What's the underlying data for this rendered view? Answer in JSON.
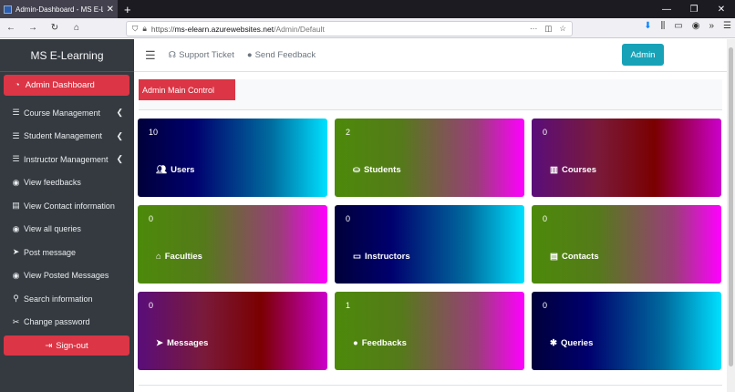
{
  "browser": {
    "tab_title": "Admin-Dashboard - MS E-Lear",
    "url_host": "ms-elearn.azurewebsites.net",
    "url_path": "/Admin/Default",
    "url_scheme": "https://"
  },
  "sidebar": {
    "brand": "MS E-Learning",
    "active_item": "Admin Dashboard",
    "items": [
      {
        "label": "Course Management",
        "icon": "list-icon",
        "has_chevron": true
      },
      {
        "label": "Student Management",
        "icon": "list-icon",
        "has_chevron": true
      },
      {
        "label": "Instructor Management",
        "icon": "list-icon",
        "has_chevron": true
      },
      {
        "label": "View feedbacks",
        "icon": "eye-icon"
      },
      {
        "label": "View Contact information",
        "icon": "id-card-icon"
      },
      {
        "label": "View all queries",
        "icon": "eye-icon"
      },
      {
        "label": "Post message",
        "icon": "paper-plane-icon"
      },
      {
        "label": "View Posted Messages",
        "icon": "eye-icon"
      },
      {
        "label": "Search information",
        "icon": "search-icon"
      },
      {
        "label": "Change password",
        "icon": "tools-icon"
      }
    ],
    "signout": "Sign-out"
  },
  "topnav": {
    "support": "Support Ticket",
    "feedback": "Send Feedback",
    "admin_button": "Admin"
  },
  "main": {
    "control_label": "Admin Main Control"
  },
  "cards": [
    {
      "count": "10",
      "label": "Users",
      "icon": "users-icon"
    },
    {
      "count": "2",
      "label": "Students",
      "icon": "graduate-icon"
    },
    {
      "count": "0",
      "label": "Courses",
      "icon": "book-icon"
    },
    {
      "count": "0",
      "label": "Faculties",
      "icon": "building-icon"
    },
    {
      "count": "0",
      "label": "Instructors",
      "icon": "chalkboard-icon"
    },
    {
      "count": "0",
      "label": "Contacts",
      "icon": "id-card-icon"
    },
    {
      "count": "0",
      "label": "Messages",
      "icon": "paper-plane-icon"
    },
    {
      "count": "1",
      "label": "Feedbacks",
      "icon": "comment-icon"
    },
    {
      "count": "0",
      "label": "Queries",
      "icon": "bug-icon"
    }
  ],
  "colors": {
    "sidebar_bg": "#343a40",
    "danger": "#dc3545",
    "info": "#17a2b8"
  }
}
